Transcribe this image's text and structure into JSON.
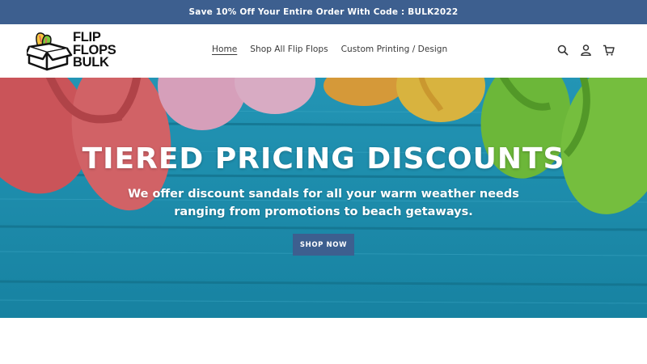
{
  "announcement": {
    "text": "Save 10% Off Your Entire Order With Code : BULK2022"
  },
  "header": {
    "logo": {
      "line1": "FLIP",
      "line2": "FLOPS",
      "line3": "BULK"
    },
    "nav": [
      {
        "label": "Home",
        "active": true
      },
      {
        "label": "Shop All Flip Flops",
        "active": false
      },
      {
        "label": "Custom Printing / Design",
        "active": false
      }
    ],
    "icons": [
      "search-icon",
      "account-icon",
      "cart-icon"
    ]
  },
  "hero": {
    "title": "TIERED PRICING DISCOUNTS",
    "subtitle": "We offer discount sandals for all your warm weather needs ranging from promotions to beach getaways.",
    "button_label": "SHOP NOW"
  },
  "colors": {
    "accent": "#3d5f8f",
    "hero_background": "#2aa6c4",
    "flipflop_red": "#e65a5e",
    "flipflop_pink": "#f2a6c4",
    "flipflop_yellow": "#f6c640",
    "flipflop_green": "#7ccb3a"
  }
}
